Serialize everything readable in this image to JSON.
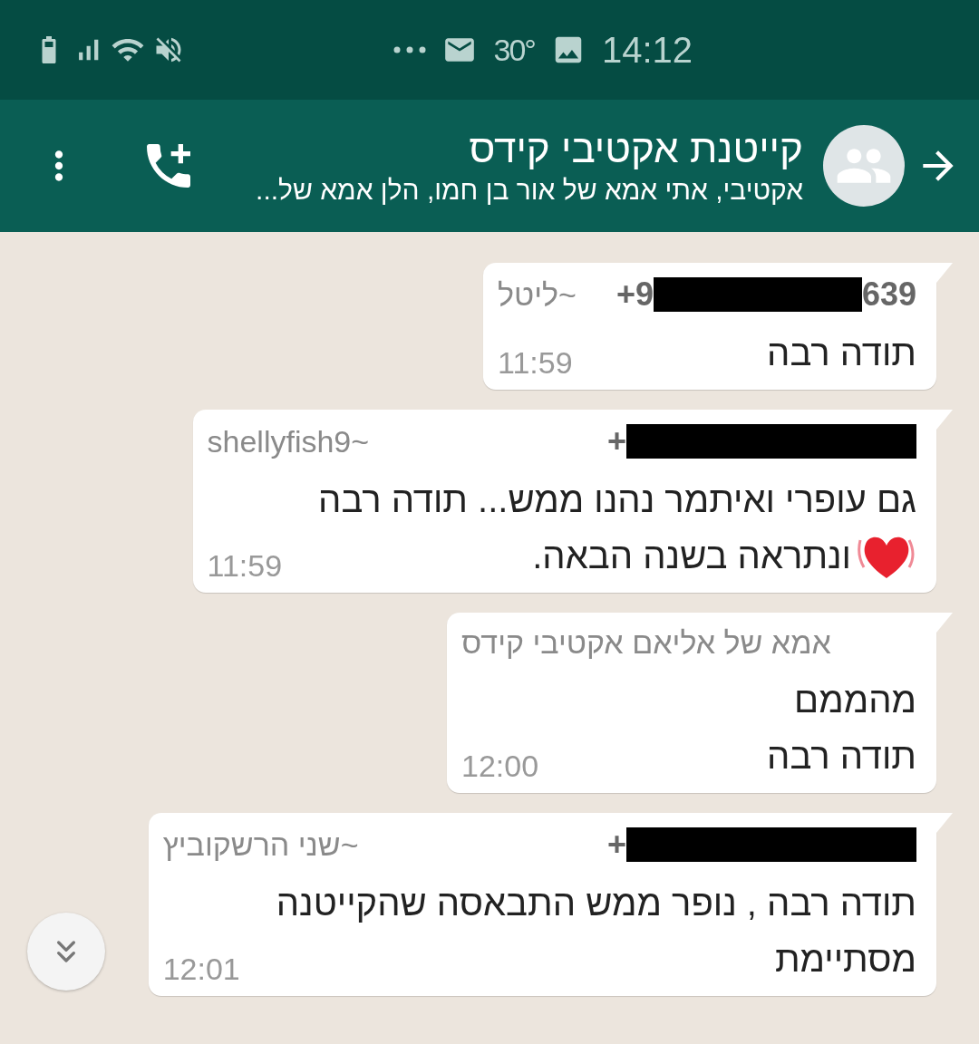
{
  "status_bar": {
    "temperature": "30°",
    "time": "14:12"
  },
  "header": {
    "title": "קייטנת אקטיבי קידס",
    "subtitle": "אקטיבי, אתי אמא של אור בן חמו, הלן אמא של..."
  },
  "messages": [
    {
      "sender": "~ליטל",
      "phone": {
        "prefix": "+9",
        "suffix": "639"
      },
      "lines": [
        "תודה רבה"
      ],
      "time": "11:59",
      "heart": false
    },
    {
      "sender": "~shellyfish9",
      "phone": {
        "prefix": "+"
      },
      "lines": [
        "גם עופרי ואיתמר נהנו ממש... תודה רבה",
        "ונתראה בשנה הבאה."
      ],
      "time": "11:59",
      "heart": true
    },
    {
      "sender": "אמא של אליאם אקטיבי קידס",
      "lines": [
        "מהממם",
        "תודה רבה"
      ],
      "time": "12:00",
      "heart": false
    },
    {
      "sender": "~שני הרשקוביץ",
      "phone": {
        "prefix": "+"
      },
      "lines": [
        "תודה רבה , נופר ממש התבאסה שהקייטנה",
        "מסתיימת"
      ],
      "time": "12:01",
      "heart": false
    }
  ]
}
